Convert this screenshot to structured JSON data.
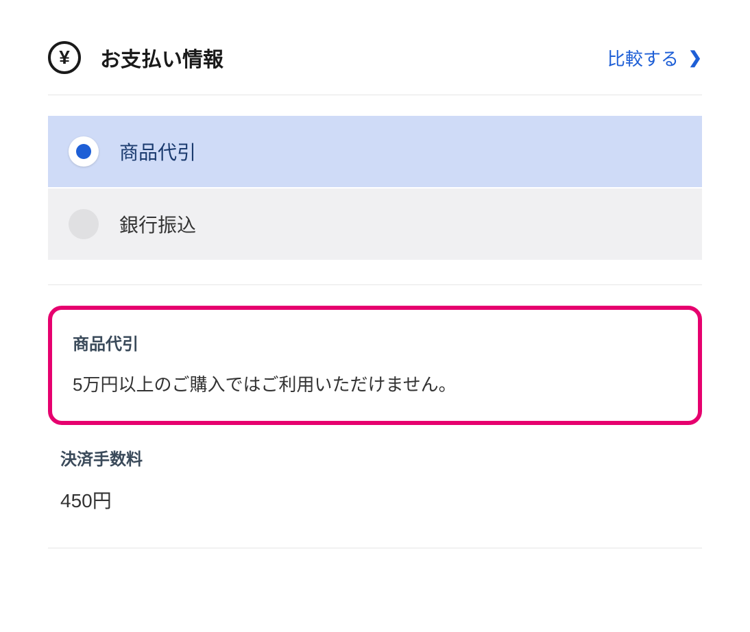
{
  "header": {
    "title": "お支払い情報",
    "compare_label": "比較する"
  },
  "options": [
    {
      "label": "商品代引",
      "selected": true
    },
    {
      "label": "銀行振込",
      "selected": false
    }
  ],
  "info_box": {
    "title": "商品代引",
    "text": "5万円以上のご購入ではご利用いただけません。"
  },
  "fee": {
    "title": "決済手数料",
    "value": "450円"
  },
  "colors": {
    "accent": "#1e5fd6",
    "highlight_border": "#e6006e",
    "selected_bg": "#cfdbf7"
  }
}
